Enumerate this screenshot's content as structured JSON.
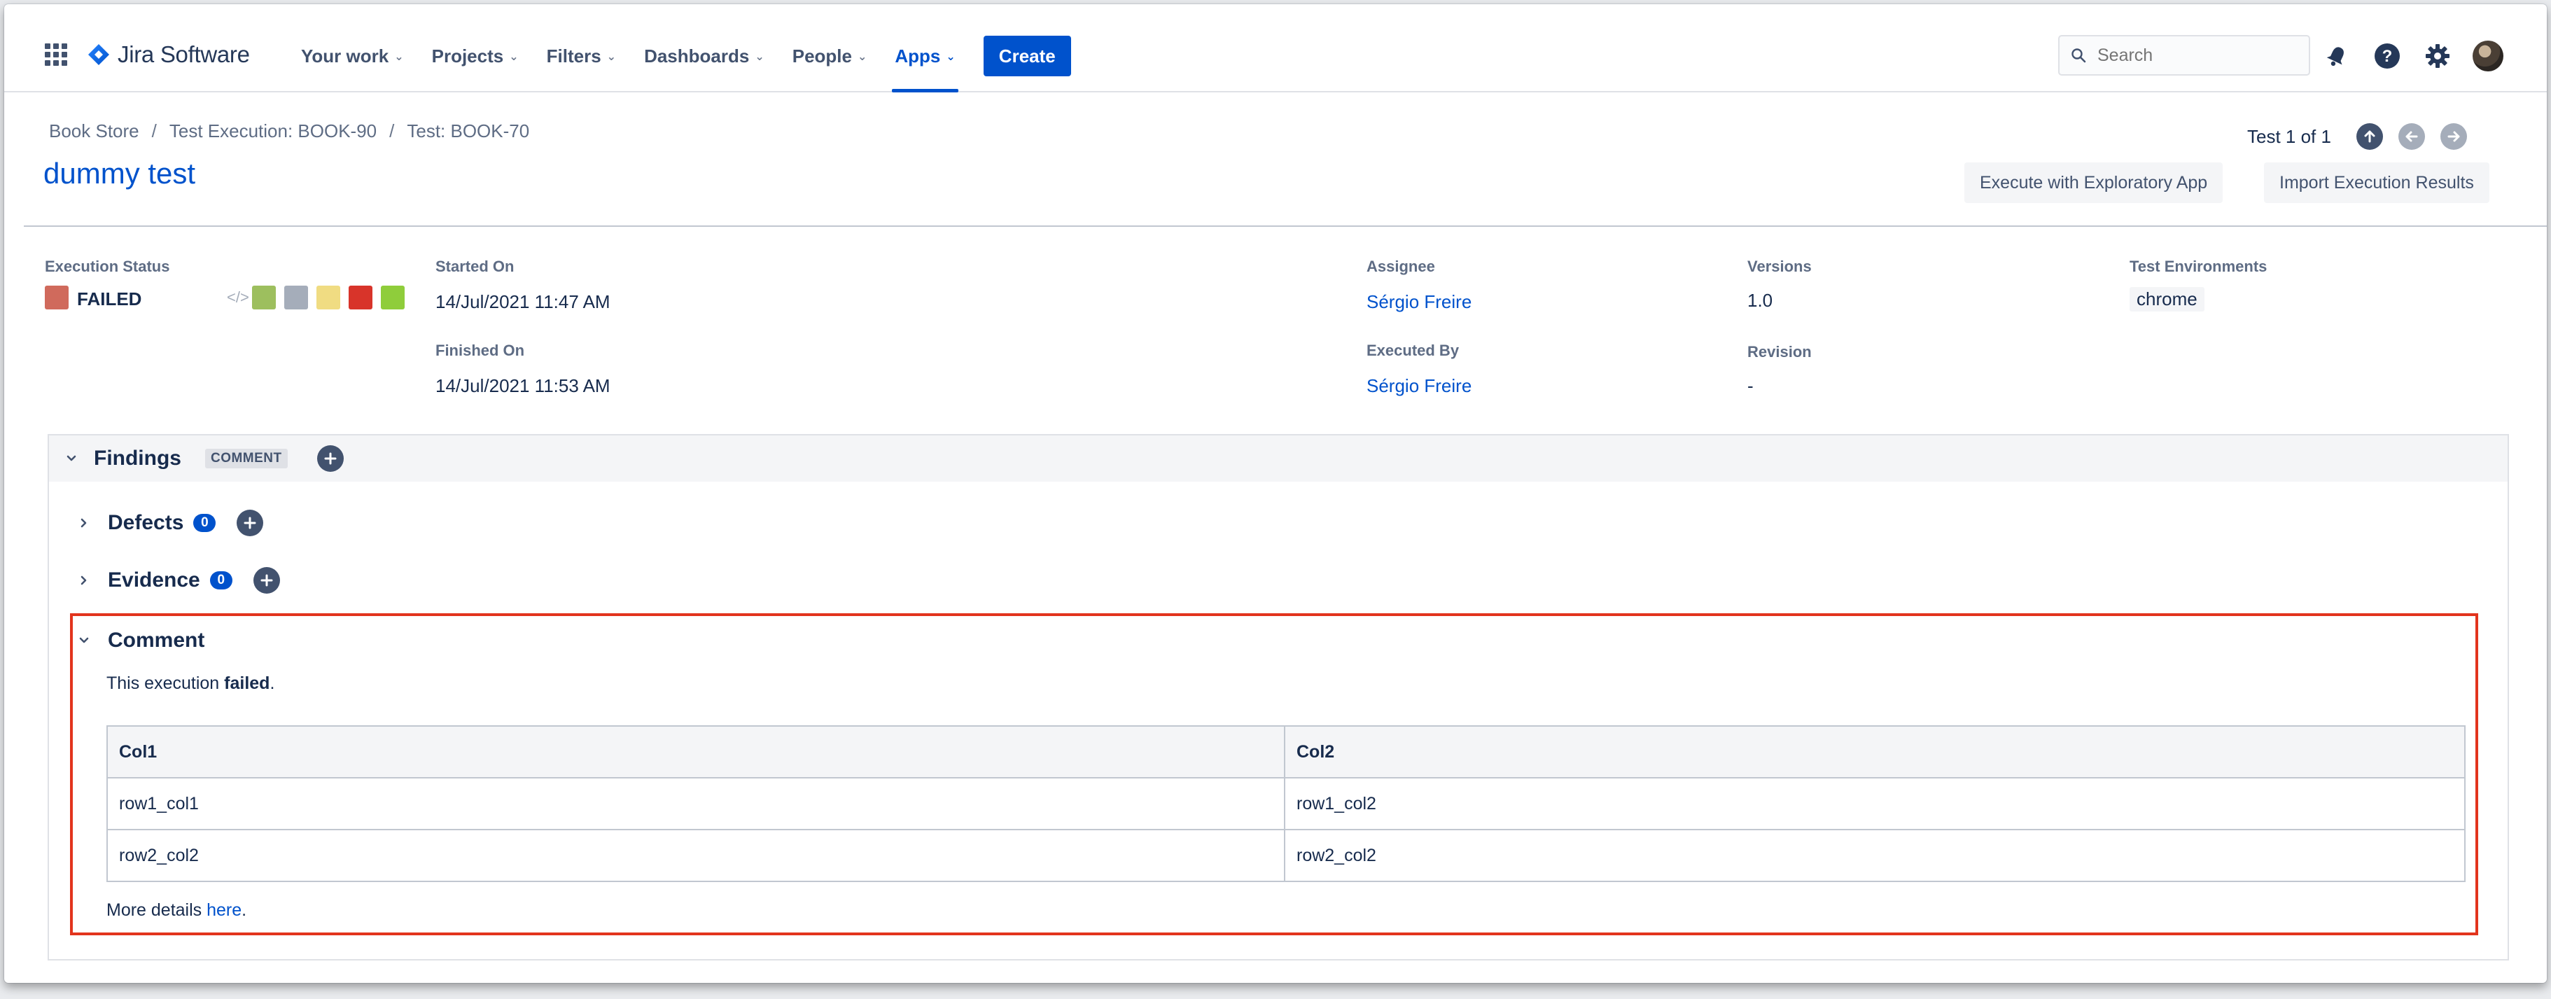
{
  "nav": {
    "product": "Jira Software",
    "items": [
      {
        "label": "Your work"
      },
      {
        "label": "Projects"
      },
      {
        "label": "Filters"
      },
      {
        "label": "Dashboards"
      },
      {
        "label": "People"
      },
      {
        "label": "Apps"
      }
    ],
    "create_label": "Create",
    "search_placeholder": "Search",
    "active_item": "Apps",
    "accent_color": "#0052cc"
  },
  "breadcrumb": [
    "Book Store",
    "Test Execution: BOOK-90",
    "Test: BOOK-70"
  ],
  "page_title": "dummy test",
  "pager": {
    "text": "Test 1 of 1"
  },
  "actions": {
    "exploratory": "Execute with Exploratory App",
    "import": "Import Execution Results"
  },
  "details": {
    "execution_status": {
      "label": "Execution Status",
      "value": "FAILED",
      "color": "#d06a5c",
      "step_colors": [
        "#9dbf5e",
        "#a5adba",
        "#f0dc82",
        "#d8342a",
        "#8fcd3b"
      ]
    },
    "started_on": {
      "label": "Started On",
      "value": "14/Jul/2021 11:47 AM"
    },
    "finished_on": {
      "label": "Finished On",
      "value": "14/Jul/2021 11:53 AM"
    },
    "assignee": {
      "label": "Assignee",
      "value": "Sérgio Freire"
    },
    "executed_by": {
      "label": "Executed By",
      "value": "Sérgio Freire"
    },
    "versions": {
      "label": "Versions",
      "value": "1.0"
    },
    "revision": {
      "label": "Revision",
      "value": "-"
    },
    "test_environments": {
      "label": "Test Environments",
      "value": "chrome"
    }
  },
  "findings": {
    "title": "Findings",
    "tag": "COMMENT",
    "defects": {
      "title": "Defects",
      "count": "0"
    },
    "evidence": {
      "title": "Evidence",
      "count": "0"
    },
    "comment": {
      "title": "Comment",
      "line1_prefix": "This execution ",
      "line1_bold": "failed",
      "line1_suffix": ".",
      "table": {
        "headers": [
          "Col1",
          "Col2"
        ],
        "rows": [
          [
            "row1_col1",
            "row1_col2"
          ],
          [
            "row2_col2",
            "row2_col2"
          ]
        ]
      },
      "footer_prefix": "More details ",
      "footer_link": "here",
      "footer_suffix": "."
    }
  }
}
